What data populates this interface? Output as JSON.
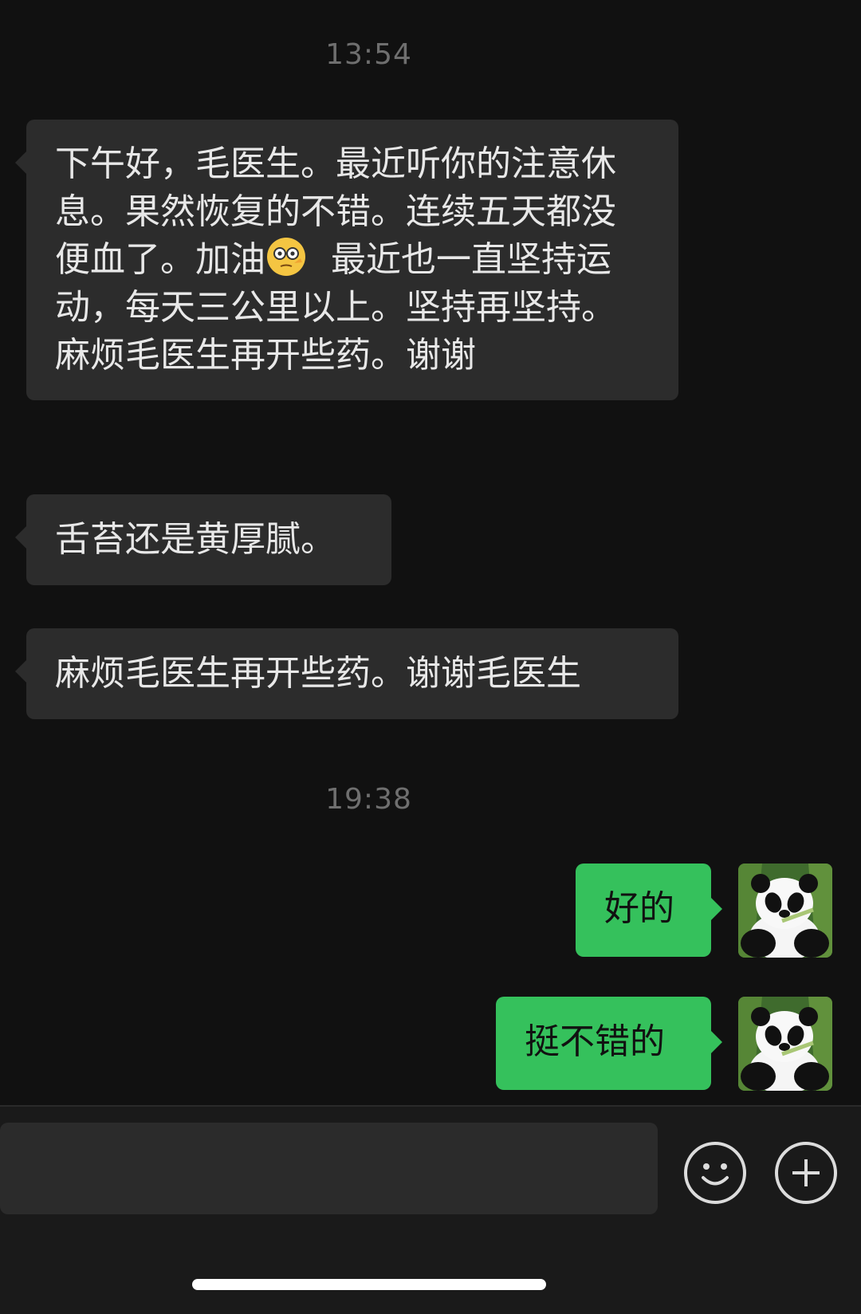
{
  "chat": {
    "time1": "13:54",
    "msg1": "下午好，毛医生。最近听你的注意休息。果然恢复的不错。连续五天都没便血了。加油",
    "msg1b": "最近也一直坚持运动，每天三公里以上。坚持再坚持。麻烦毛医生再开些药。谢谢",
    "msg2": "舌苔还是黄厚腻。",
    "msg3": "麻烦毛医生再开些药。谢谢毛医生",
    "time2": "19:38",
    "reply1": "好的",
    "reply2": "挺不错的"
  },
  "icons": {
    "emoji_in_message": "face-with-monocle-like-emoji-icon",
    "emoji_button": "smile-icon",
    "plus_button": "plus-icon",
    "avatar": "panda-avatar"
  },
  "colors": {
    "background": "#111111",
    "incoming_bubble": "#2c2c2c",
    "outgoing_bubble": "#35c15c"
  }
}
